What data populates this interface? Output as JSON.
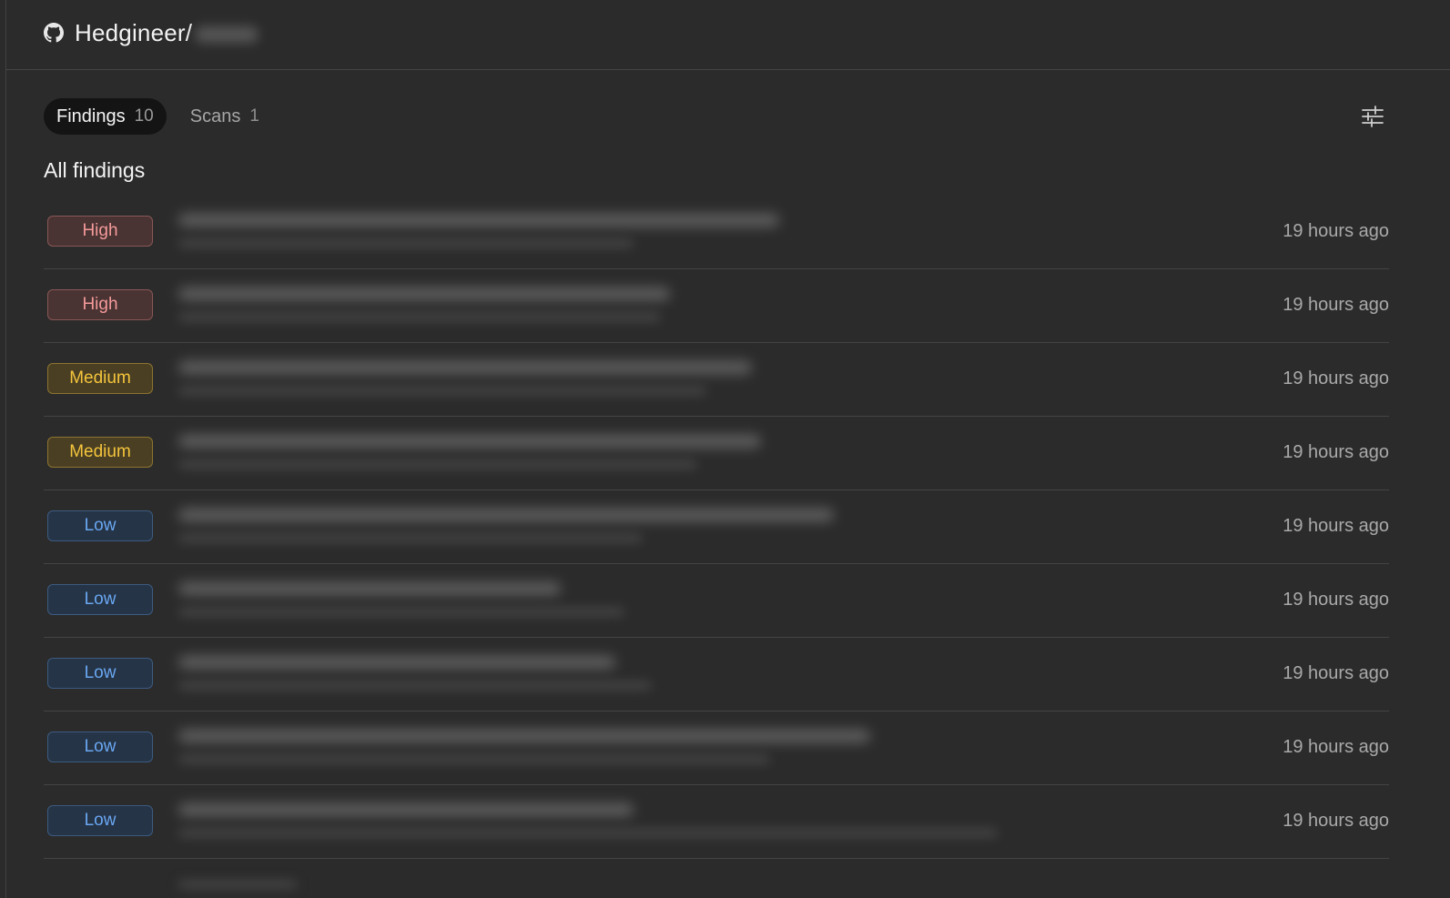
{
  "header": {
    "repo_owner": "Hedgineer/",
    "repo_name": "",
    "icon": "github-icon"
  },
  "tabs": [
    {
      "label": "Findings",
      "count": "10",
      "active": true
    },
    {
      "label": "Scans",
      "count": "1",
      "active": false
    }
  ],
  "toolbar": {
    "filter_icon": "sliders-icon"
  },
  "section_title": "All findings",
  "findings": [
    {
      "severity": "High",
      "time": "19 hours ago"
    },
    {
      "severity": "High",
      "time": "19 hours ago"
    },
    {
      "severity": "Medium",
      "time": "19 hours ago"
    },
    {
      "severity": "Medium",
      "time": "19 hours ago"
    },
    {
      "severity": "Low",
      "time": "19 hours ago"
    },
    {
      "severity": "Low",
      "time": "19 hours ago"
    },
    {
      "severity": "Low",
      "time": "19 hours ago"
    },
    {
      "severity": "Low",
      "time": "19 hours ago"
    },
    {
      "severity": "Low",
      "time": "19 hours ago"
    }
  ],
  "colors": {
    "background": "#2b2b2b",
    "high": "#f49a9a",
    "medium": "#f5c53c",
    "low": "#6aa7f2"
  }
}
